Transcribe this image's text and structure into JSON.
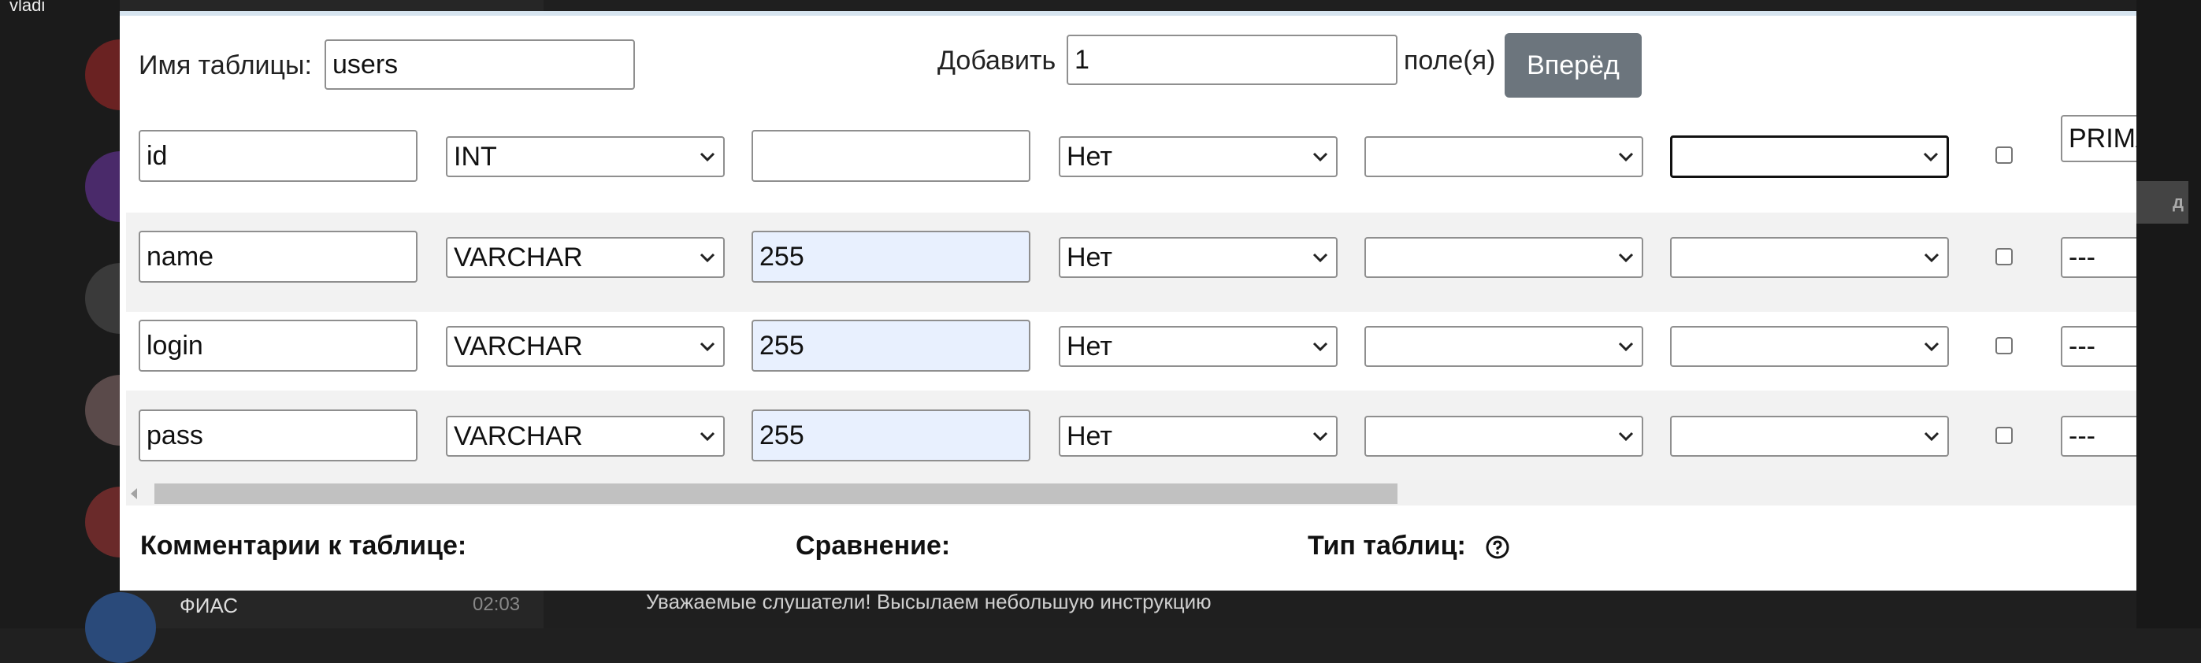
{
  "background": {
    "user_name": "vladi",
    "list_item_title": "ФИАС",
    "list_item_time": "02:03",
    "message_text": "Уважаемые слушатели! Высылаем небольшую инструкцию",
    "right_tag": "д"
  },
  "form": {
    "table_name_label": "Имя таблицы:",
    "table_name_value": "users",
    "add_label": "Добавить",
    "add_value": "1",
    "fields_label": "поле(я)",
    "go_button": "Вперёд"
  },
  "columns": [
    {
      "name": "id",
      "type": "INT",
      "length": "",
      "default": "Нет",
      "collation": "",
      "attributes": "",
      "index": "PRIMA"
    },
    {
      "name": "name",
      "type": "VARCHAR",
      "length": "255",
      "default": "Нет",
      "collation": "",
      "attributes": "",
      "index": "---"
    },
    {
      "name": "login",
      "type": "VARCHAR",
      "length": "255",
      "default": "Нет",
      "collation": "",
      "attributes": "",
      "index": "---"
    },
    {
      "name": "pass",
      "type": "VARCHAR",
      "length": "255",
      "default": "Нет",
      "collation": "",
      "attributes": "",
      "index": "---"
    }
  ],
  "footer": {
    "comments_label": "Комментарии к таблице:",
    "collation_label": "Сравнение:",
    "table_type_label": "Тип таблиц:"
  },
  "colors": {
    "button_bg": "#6c757d",
    "length_field_bg": "#e8f0fe",
    "stripe_bg": "#f2f2f2"
  },
  "icons": [
    "chevron-down-icon",
    "help-icon",
    "scroll-left-icon"
  ]
}
